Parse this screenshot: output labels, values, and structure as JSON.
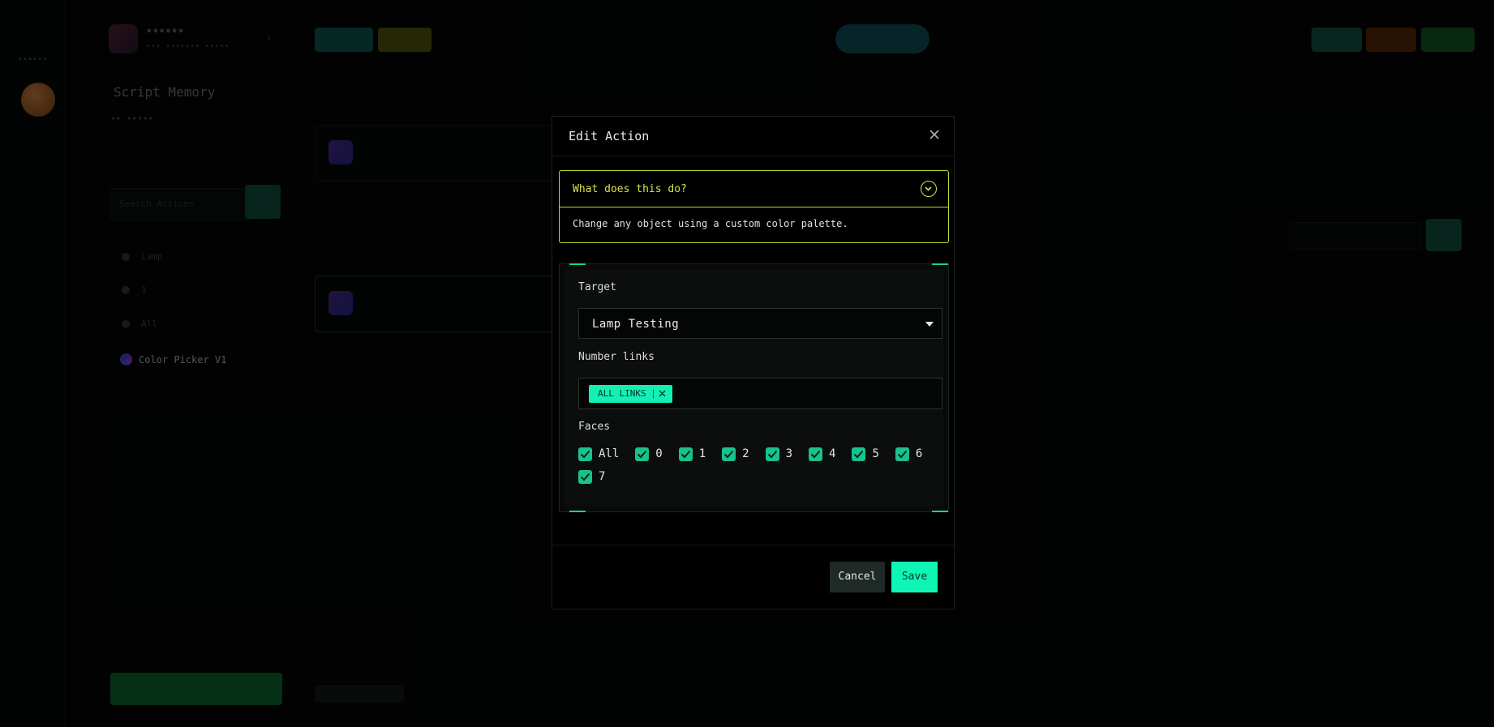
{
  "background": {
    "rail": {
      "label": "••••••"
    },
    "sidebar": {
      "brand_title": "••••••",
      "brand_sub": "••• ••••••• •••••",
      "project": "Script Memory",
      "project_sub": "•• •••••",
      "search_placeholder": "Search Actions",
      "items": [
        "Lamp",
        "1",
        "All"
      ],
      "color_picker_label": "Color Picker V1"
    }
  },
  "modal": {
    "title": "Edit Action",
    "close_icon": "close-icon",
    "info": {
      "question": "What does this do?",
      "description": "Change any object using a custom color palette."
    },
    "form": {
      "target_label": "Target",
      "target_value": "Lamp Testing",
      "number_links_label": "Number links",
      "number_links_chips": [
        "ALL LINKS"
      ],
      "faces_label": "Faces",
      "faces": [
        {
          "label": "All",
          "checked": true
        },
        {
          "label": "0",
          "checked": true
        },
        {
          "label": "1",
          "checked": true
        },
        {
          "label": "2",
          "checked": true
        },
        {
          "label": "3",
          "checked": true
        },
        {
          "label": "4",
          "checked": true
        },
        {
          "label": "5",
          "checked": true
        },
        {
          "label": "6",
          "checked": true
        },
        {
          "label": "7",
          "checked": true
        }
      ]
    },
    "footer": {
      "cancel_label": "Cancel",
      "save_label": "Save"
    }
  },
  "colors": {
    "accent": "#12f0b6",
    "info_border": "#c7d62a",
    "checkbox": "#19c28c"
  }
}
